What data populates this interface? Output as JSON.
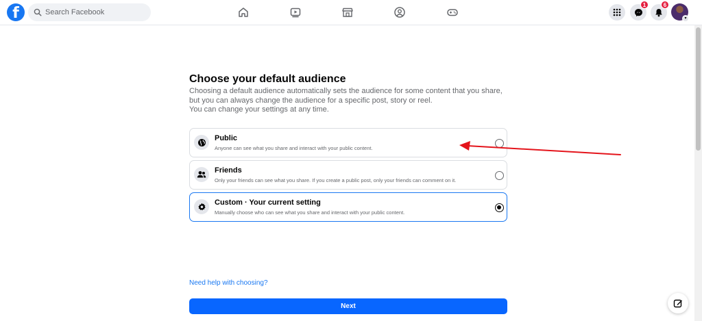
{
  "topbar": {
    "logo_letter": "f",
    "search_placeholder": "Search Facebook",
    "nav": [
      {
        "name": "home-icon"
      },
      {
        "name": "video-icon"
      },
      {
        "name": "marketplace-icon"
      },
      {
        "name": "groups-icon"
      },
      {
        "name": "gaming-icon"
      }
    ],
    "messenger_badge": "1",
    "notifications_badge": "6"
  },
  "main": {
    "title": "Choose your default audience",
    "description_lines": [
      "Choosing a default audience automatically sets the audience for some content that you share,",
      "but you can always change the audience for a specific post, story or reel.",
      "You can change your settings at any time."
    ],
    "options": [
      {
        "label": "Public",
        "sub": "Anyone can see what you share and interact with your public content.",
        "icon": "globe-icon",
        "selected": false
      },
      {
        "label": "Friends",
        "sub": "Only your friends can see what you share. If you create a public post, only your friends can comment on it.",
        "icon": "friends-icon",
        "selected": false
      },
      {
        "label": "Custom · Your current setting",
        "sub": "Manually choose who can see what you share and interact with your public content.",
        "icon": "gear-icon",
        "selected": true
      }
    ],
    "help_link": "Need help with choosing?",
    "next_label": "Next"
  },
  "colors": {
    "brand": "#1877f2",
    "button": "#0866ff",
    "annotation_arrow": "#e4141b",
    "badge": "#e41e3f"
  }
}
